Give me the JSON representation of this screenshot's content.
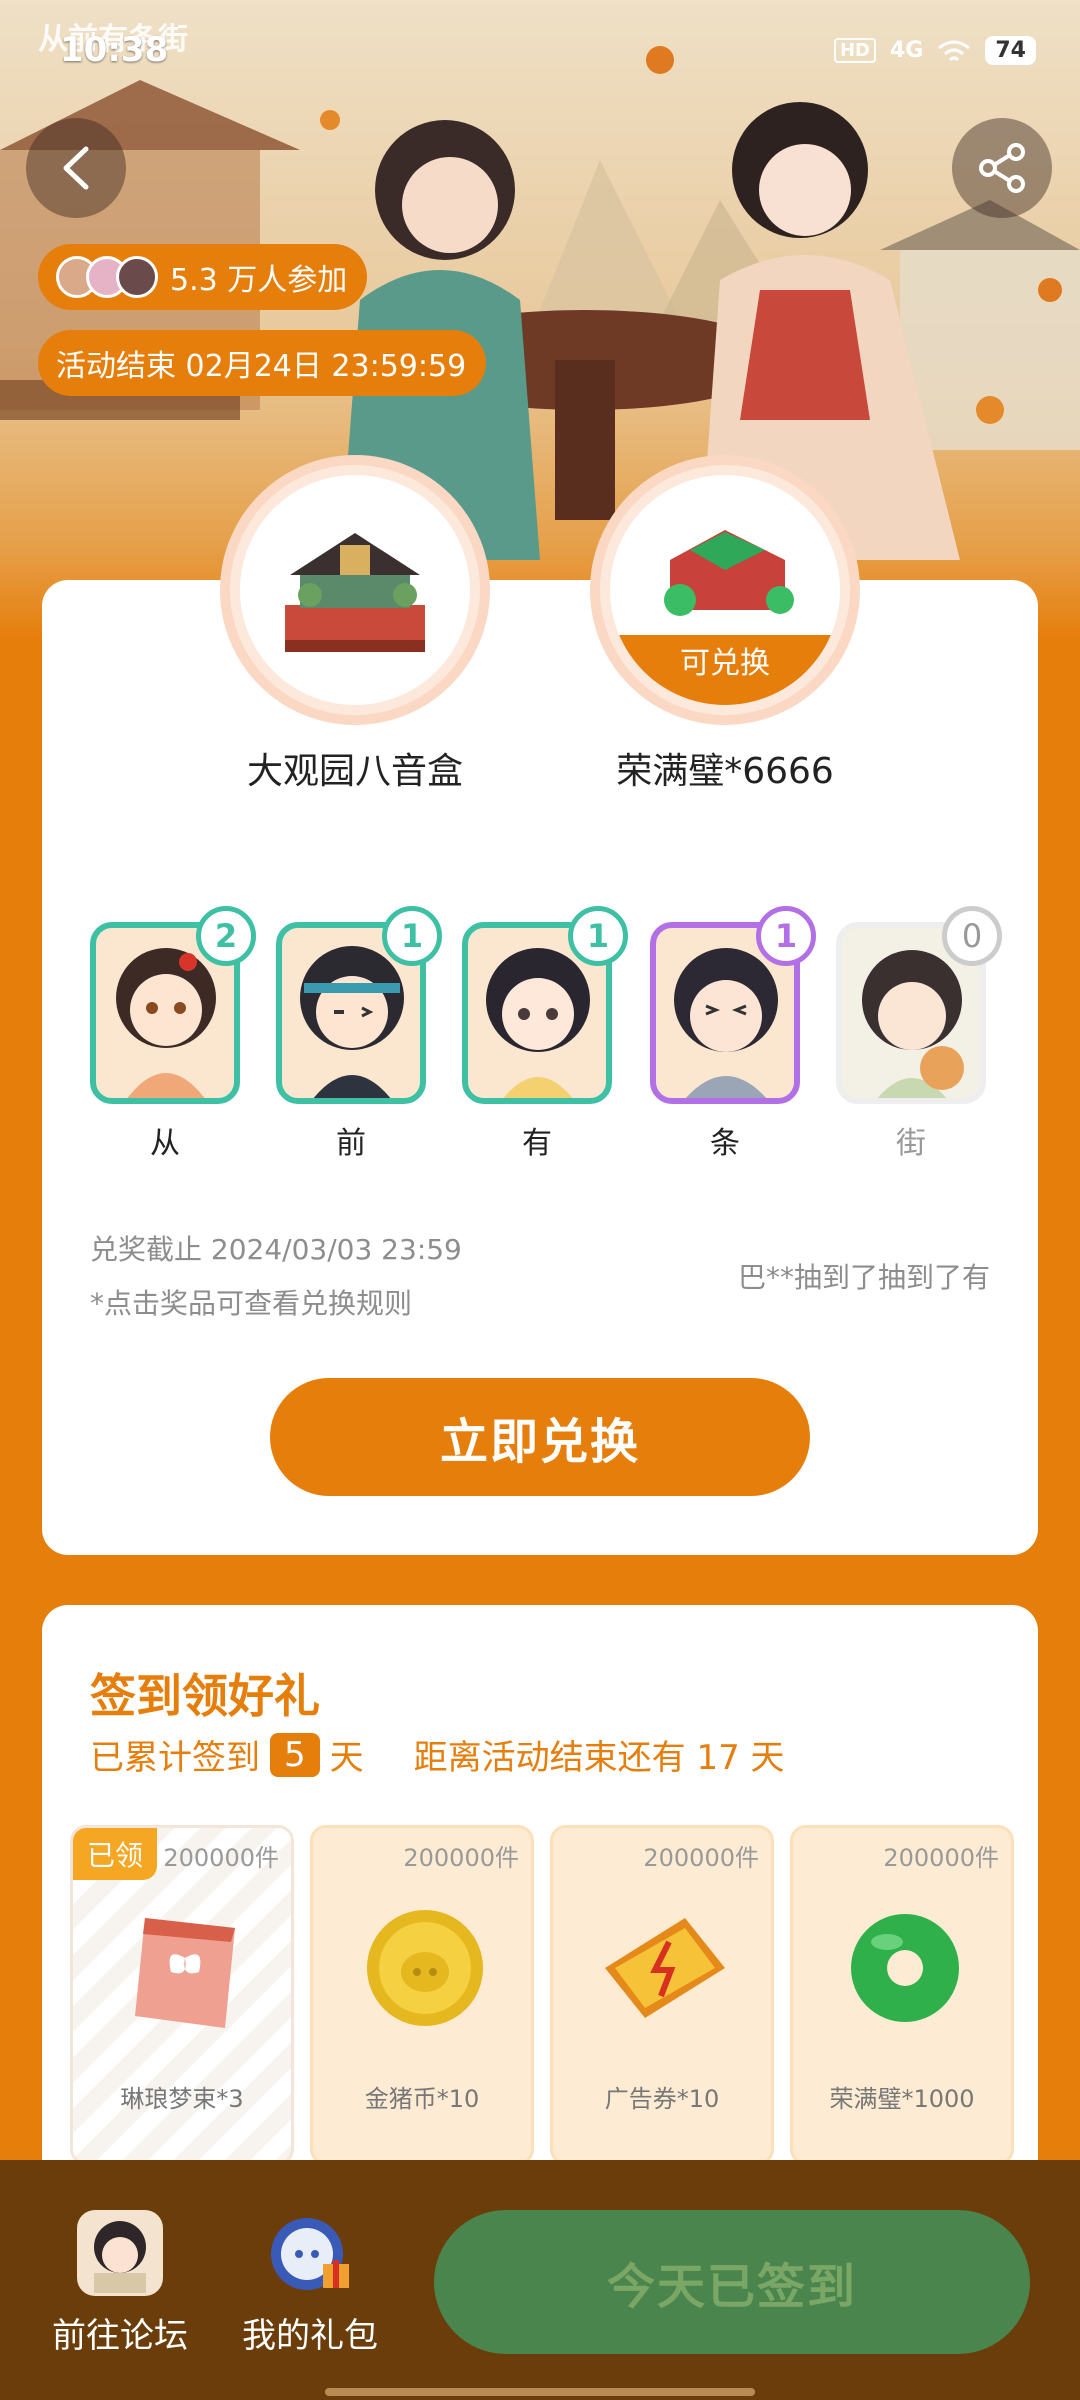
{
  "status_bar": {
    "time": "10:38",
    "logo": "从前有条街",
    "hd": "HD",
    "network": "4G",
    "battery": "74"
  },
  "header": {
    "participants": "5.3 万人参加",
    "end_time": "活动结束 02月24日 23:59:59"
  },
  "prizes": [
    {
      "name": "大观园八音盒",
      "tag": ""
    },
    {
      "name": "荣满璧*6666",
      "tag": "可兑换"
    }
  ],
  "characters": [
    {
      "label": "从",
      "count": "2"
    },
    {
      "label": "前",
      "count": "1"
    },
    {
      "label": "有",
      "count": "1"
    },
    {
      "label": "条",
      "count": "1"
    },
    {
      "label": "街",
      "count": "0"
    }
  ],
  "exchange": {
    "deadline": "兑奖截止 2024/03/03 23:59",
    "rule_hint": "*点击奖品可查看兑换规则",
    "ticker": "巴**抽到了抽到了有",
    "button": "立即兑换"
  },
  "signin": {
    "title": "签到领好礼",
    "prefix": "已累计签到",
    "days": "5",
    "day_unit": "天",
    "remaining": "距离活动结束还有 17 天",
    "rewards": [
      {
        "name": "琳琅梦束*3",
        "qty": "200000件",
        "tag": "已领"
      },
      {
        "name": "金猪币*10",
        "qty": "200000件",
        "tag": ""
      },
      {
        "name": "广告券*10",
        "qty": "200000件",
        "tag": ""
      },
      {
        "name": "荣满璧*1000",
        "qty": "200000件",
        "tag": ""
      }
    ]
  },
  "bottom": {
    "forum": "前往论坛",
    "gift": "我的礼包",
    "signed": "今天已签到"
  },
  "colors": {
    "accent": "#e67e0c",
    "teal_border": "#3ec0a5",
    "purple_border": "#b26fe6",
    "signed_button": "#4a854e",
    "bottom_bar": "#6b3d0a"
  },
  "icons": [
    "back-icon",
    "share-icon",
    "forum-avatar-icon",
    "gift-icon"
  ]
}
